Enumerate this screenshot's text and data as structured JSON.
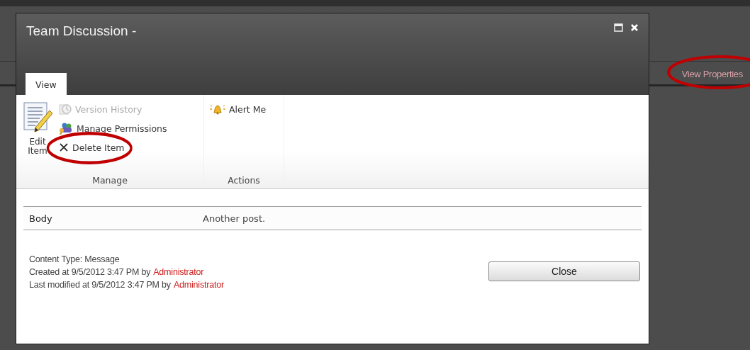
{
  "background_page": {
    "link": {
      "label": "View Properties",
      "circled": true
    }
  },
  "dialog": {
    "title": "Team Discussion -",
    "tabs": [
      {
        "label": "View",
        "selected": true
      }
    ],
    "ribbon_groups": [
      {
        "label": "Manage",
        "items": [
          {
            "kind": "large",
            "label": "Edit Item",
            "disabled": false
          },
          {
            "kind": "small",
            "label": "Version History",
            "disabled": true,
            "circled": false
          },
          {
            "kind": "small",
            "label": "Manage Permissions",
            "disabled": false,
            "circled": false
          },
          {
            "kind": "small",
            "label": "Delete Item",
            "disabled": false,
            "circled": true
          }
        ]
      },
      {
        "label": "Actions",
        "items": [
          {
            "kind": "small",
            "label": "Alert Me",
            "disabled": false,
            "circled": false
          }
        ]
      }
    ],
    "fields": [
      {
        "label": "Body",
        "value": "Another post."
      }
    ],
    "meta": {
      "content_type": "Content Type: Message",
      "lines": [
        {
          "text": "Created at 9/5/2012 3:47 PM by",
          "user": "Administrator"
        },
        {
          "text": "Last modified at 9/5/2012 3:47 PM by",
          "user": "Administrator"
        }
      ]
    },
    "buttons": [
      {
        "label": "Close"
      }
    ]
  }
}
